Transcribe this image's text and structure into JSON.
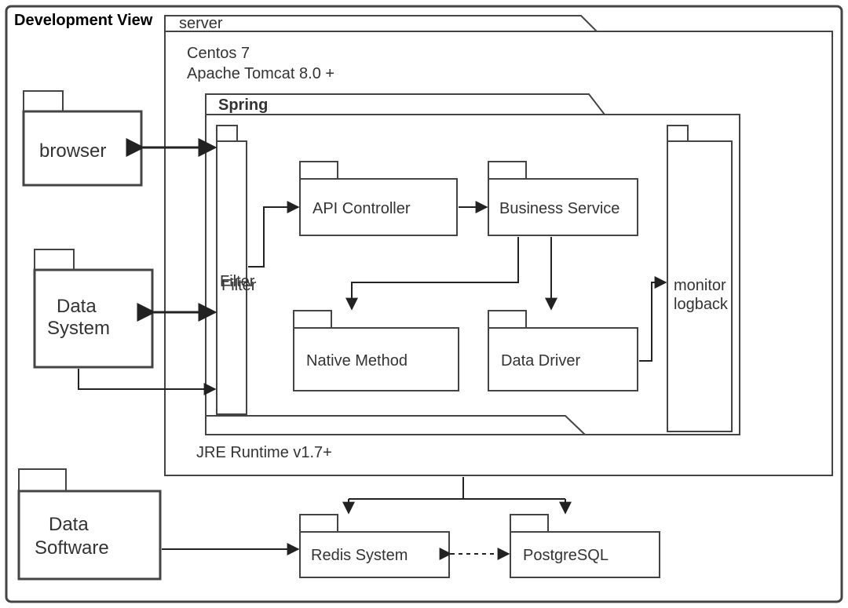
{
  "diagram": {
    "title": "Development View",
    "server": {
      "label": "server",
      "os": "Centos 7",
      "container": "Apache Tomcat 8.0 +",
      "runtime": "JRE Runtime v1.7+",
      "spring": {
        "label": "Spring",
        "components": {
          "filter": "Filter",
          "api_controller": "API Controller",
          "business_service": "Business Service",
          "native_method": "Native Method",
          "data_driver": "Data Driver",
          "monitor": "monitor logback"
        }
      }
    },
    "external": {
      "browser": "browser",
      "data_system": "Data System",
      "data_software": "Data Software"
    },
    "storage": {
      "redis": "Redis System",
      "postgres": "PostgreSQL"
    }
  }
}
